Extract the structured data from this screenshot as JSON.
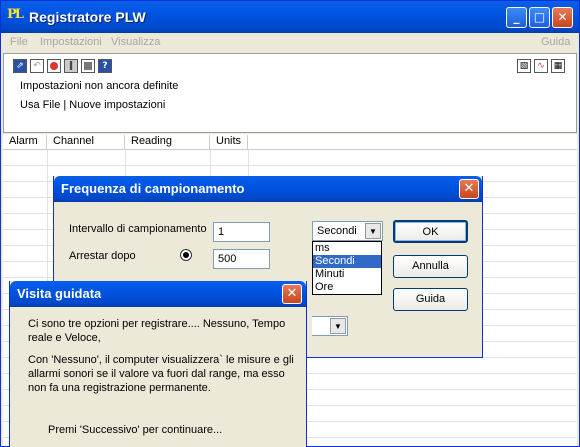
{
  "window": {
    "title": "Registratore PLW",
    "icon": "plw-logo-icon"
  },
  "menu": {
    "items": [
      "File",
      "Impostazioni",
      "Visualizza"
    ],
    "help": "Guida"
  },
  "toolbar": {
    "status_line1": "Impostazioni non ancora definite",
    "status_line2": "Usa File | Nuove impostazioni"
  },
  "grid": {
    "columns": [
      "Alarm",
      "Channel",
      "Reading",
      "Units"
    ]
  },
  "sampling_dialog": {
    "title": "Frequenza di campionamento",
    "interval_label": "Intervallo di campionamento",
    "interval_value": "1",
    "interval_unit": "Secondi",
    "unit_options": [
      "ms",
      "Secondi",
      "Minuti",
      "Ore"
    ],
    "unit_selected": "Secondi",
    "stop_after_label": "Arrestar dopo",
    "stop_after_value": "500",
    "ok_label": "OK",
    "cancel_label": "Annulla",
    "help_label": "Guida"
  },
  "guided_tour": {
    "title": "Visita guidata",
    "para1": "Ci sono tre opzioni per registrare.... Nessuno, Tempo reale e Veloce,",
    "para2": "Con 'Nessuno', il computer visualizzera` le misure e gli allarmi sonori se il valore va fuori dal range, ma esso non fa una registrazione permanente.",
    "para3": "Premi 'Successivo' per continuare..."
  },
  "colors": {
    "titlebar": "#0054E3",
    "selection": "#316AC5",
    "face": "#ECE9D8"
  }
}
